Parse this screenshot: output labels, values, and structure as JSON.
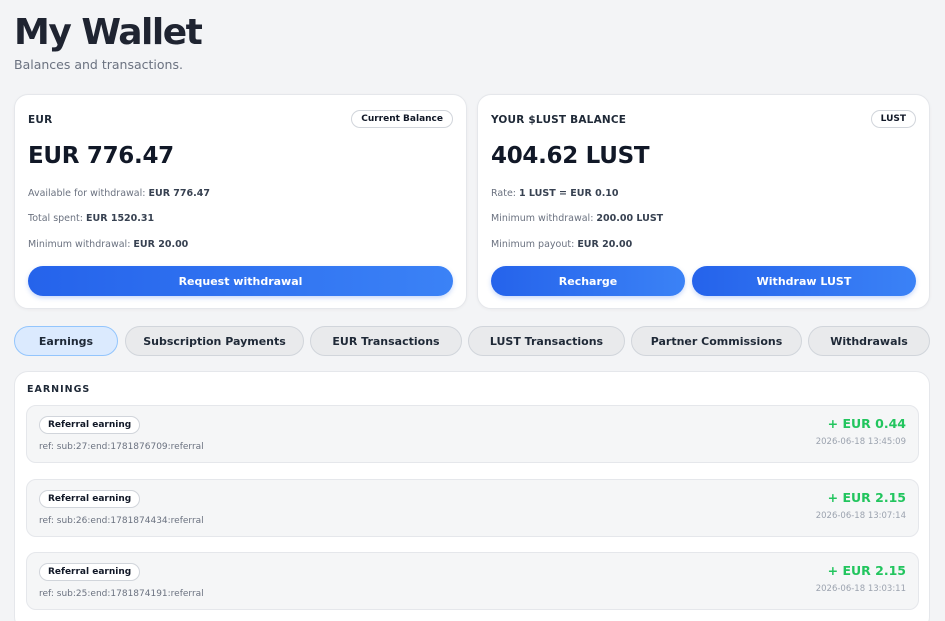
{
  "header": {
    "title": "My Wallet",
    "subtitle": "Balances and transactions."
  },
  "eur_card": {
    "label": "EUR",
    "badge": "Current Balance",
    "amount": "EUR 776.47",
    "rows": [
      {
        "label": "Available for withdrawal:",
        "value": "EUR 776.47"
      },
      {
        "label": "Total spent:",
        "value": "EUR 1520.31"
      },
      {
        "label": "Minimum withdrawal:",
        "value": "EUR 20.00"
      }
    ],
    "button": "Request withdrawal"
  },
  "lust_card": {
    "label": "YOUR $LUST BALANCE",
    "badge": "LUST",
    "amount": "404.62 LUST",
    "rows": [
      {
        "label": "Rate:",
        "value": "1 LUST = EUR 0.10"
      },
      {
        "label": "Minimum withdrawal:",
        "value": "200.00 LUST"
      },
      {
        "label": "Minimum payout:",
        "value": "EUR 20.00"
      }
    ],
    "recharge_button": "Recharge",
    "withdraw_button": "Withdraw LUST"
  },
  "tabs": [
    {
      "label": "Earnings",
      "active": true
    },
    {
      "label": "Subscription Payments",
      "active": false
    },
    {
      "label": "EUR Transactions",
      "active": false
    },
    {
      "label": "LUST Transactions",
      "active": false
    },
    {
      "label": "Partner Commissions",
      "active": false
    },
    {
      "label": "Withdrawals",
      "active": false
    }
  ],
  "earnings": {
    "title": "EARNINGS",
    "items": [
      {
        "type": "Referral earning",
        "ref": "ref: sub:27:end:1781876709:referral",
        "amount": "+ EUR 0.44",
        "date": "2026-06-18 13:45:09"
      },
      {
        "type": "Referral earning",
        "ref": "ref: sub:26:end:1781874434:referral",
        "amount": "+ EUR 2.15",
        "date": "2026-06-18 13:07:14"
      },
      {
        "type": "Referral earning",
        "ref": "ref: sub:25:end:1781874191:referral",
        "amount": "+ EUR 2.15",
        "date": "2026-06-18 13:03:11"
      }
    ]
  },
  "colors": {
    "accent": "#2563eb",
    "positive": "#22c55e",
    "active_tab": "#dbeafe"
  }
}
